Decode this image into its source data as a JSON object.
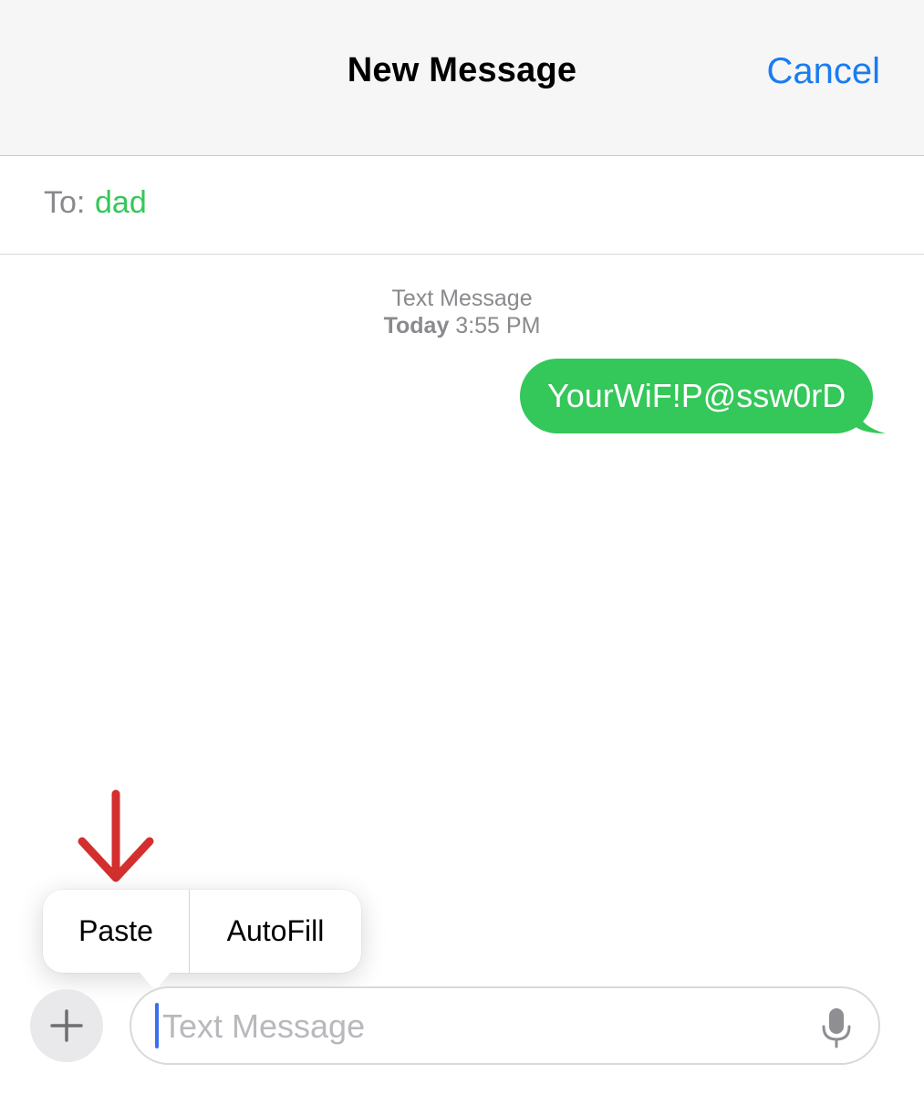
{
  "header": {
    "title": "New Message",
    "cancel_label": "Cancel"
  },
  "recipient": {
    "label": "To:",
    "name": "dad"
  },
  "conversation": {
    "service": "Text Message",
    "day": "Today",
    "time": "3:55 PM",
    "messages": [
      {
        "text": "YourWiF!P@ssw0rD",
        "sender": "me"
      }
    ]
  },
  "context_menu": {
    "items": [
      {
        "label": "Paste"
      },
      {
        "label": "AutoFill"
      }
    ]
  },
  "composer": {
    "placeholder": "Text Message",
    "value": ""
  },
  "icons": {
    "add": "plus-icon",
    "dictation": "microphone-icon",
    "annotation": "red-down-arrow"
  },
  "colors": {
    "accent_blue": "#1a7cf0",
    "sms_green": "#34c759",
    "annotation_red": "#d32f2f"
  }
}
